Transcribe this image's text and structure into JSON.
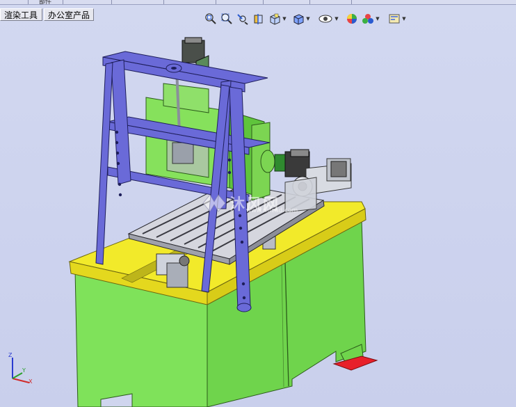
{
  "tabs": {
    "render_tools": "渲染工具",
    "office_products": "办公室产品",
    "partial_top": "部件"
  },
  "toolbar": {
    "icons": [
      "zoom-to-fit-icon",
      "zoom-to-area-icon",
      "previous-view-icon",
      "section-view-icon",
      "view-orientation-icon",
      "display-style-icon",
      "hide-show-items-icon",
      "edit-appearance-icon",
      "apply-scene-icon",
      "view-settings-icon"
    ]
  },
  "watermark": {
    "text": "沐风网",
    "sub": "www.mfcad.com"
  },
  "triad": {
    "x": "X",
    "y": "Y",
    "z": "Z"
  },
  "colors": {
    "frame_purple": "#6a6ad8",
    "body_green": "#7fe25a",
    "top_yellow": "#f2ea2a",
    "base_red": "#e8202a",
    "background": "#cfd5ee"
  }
}
